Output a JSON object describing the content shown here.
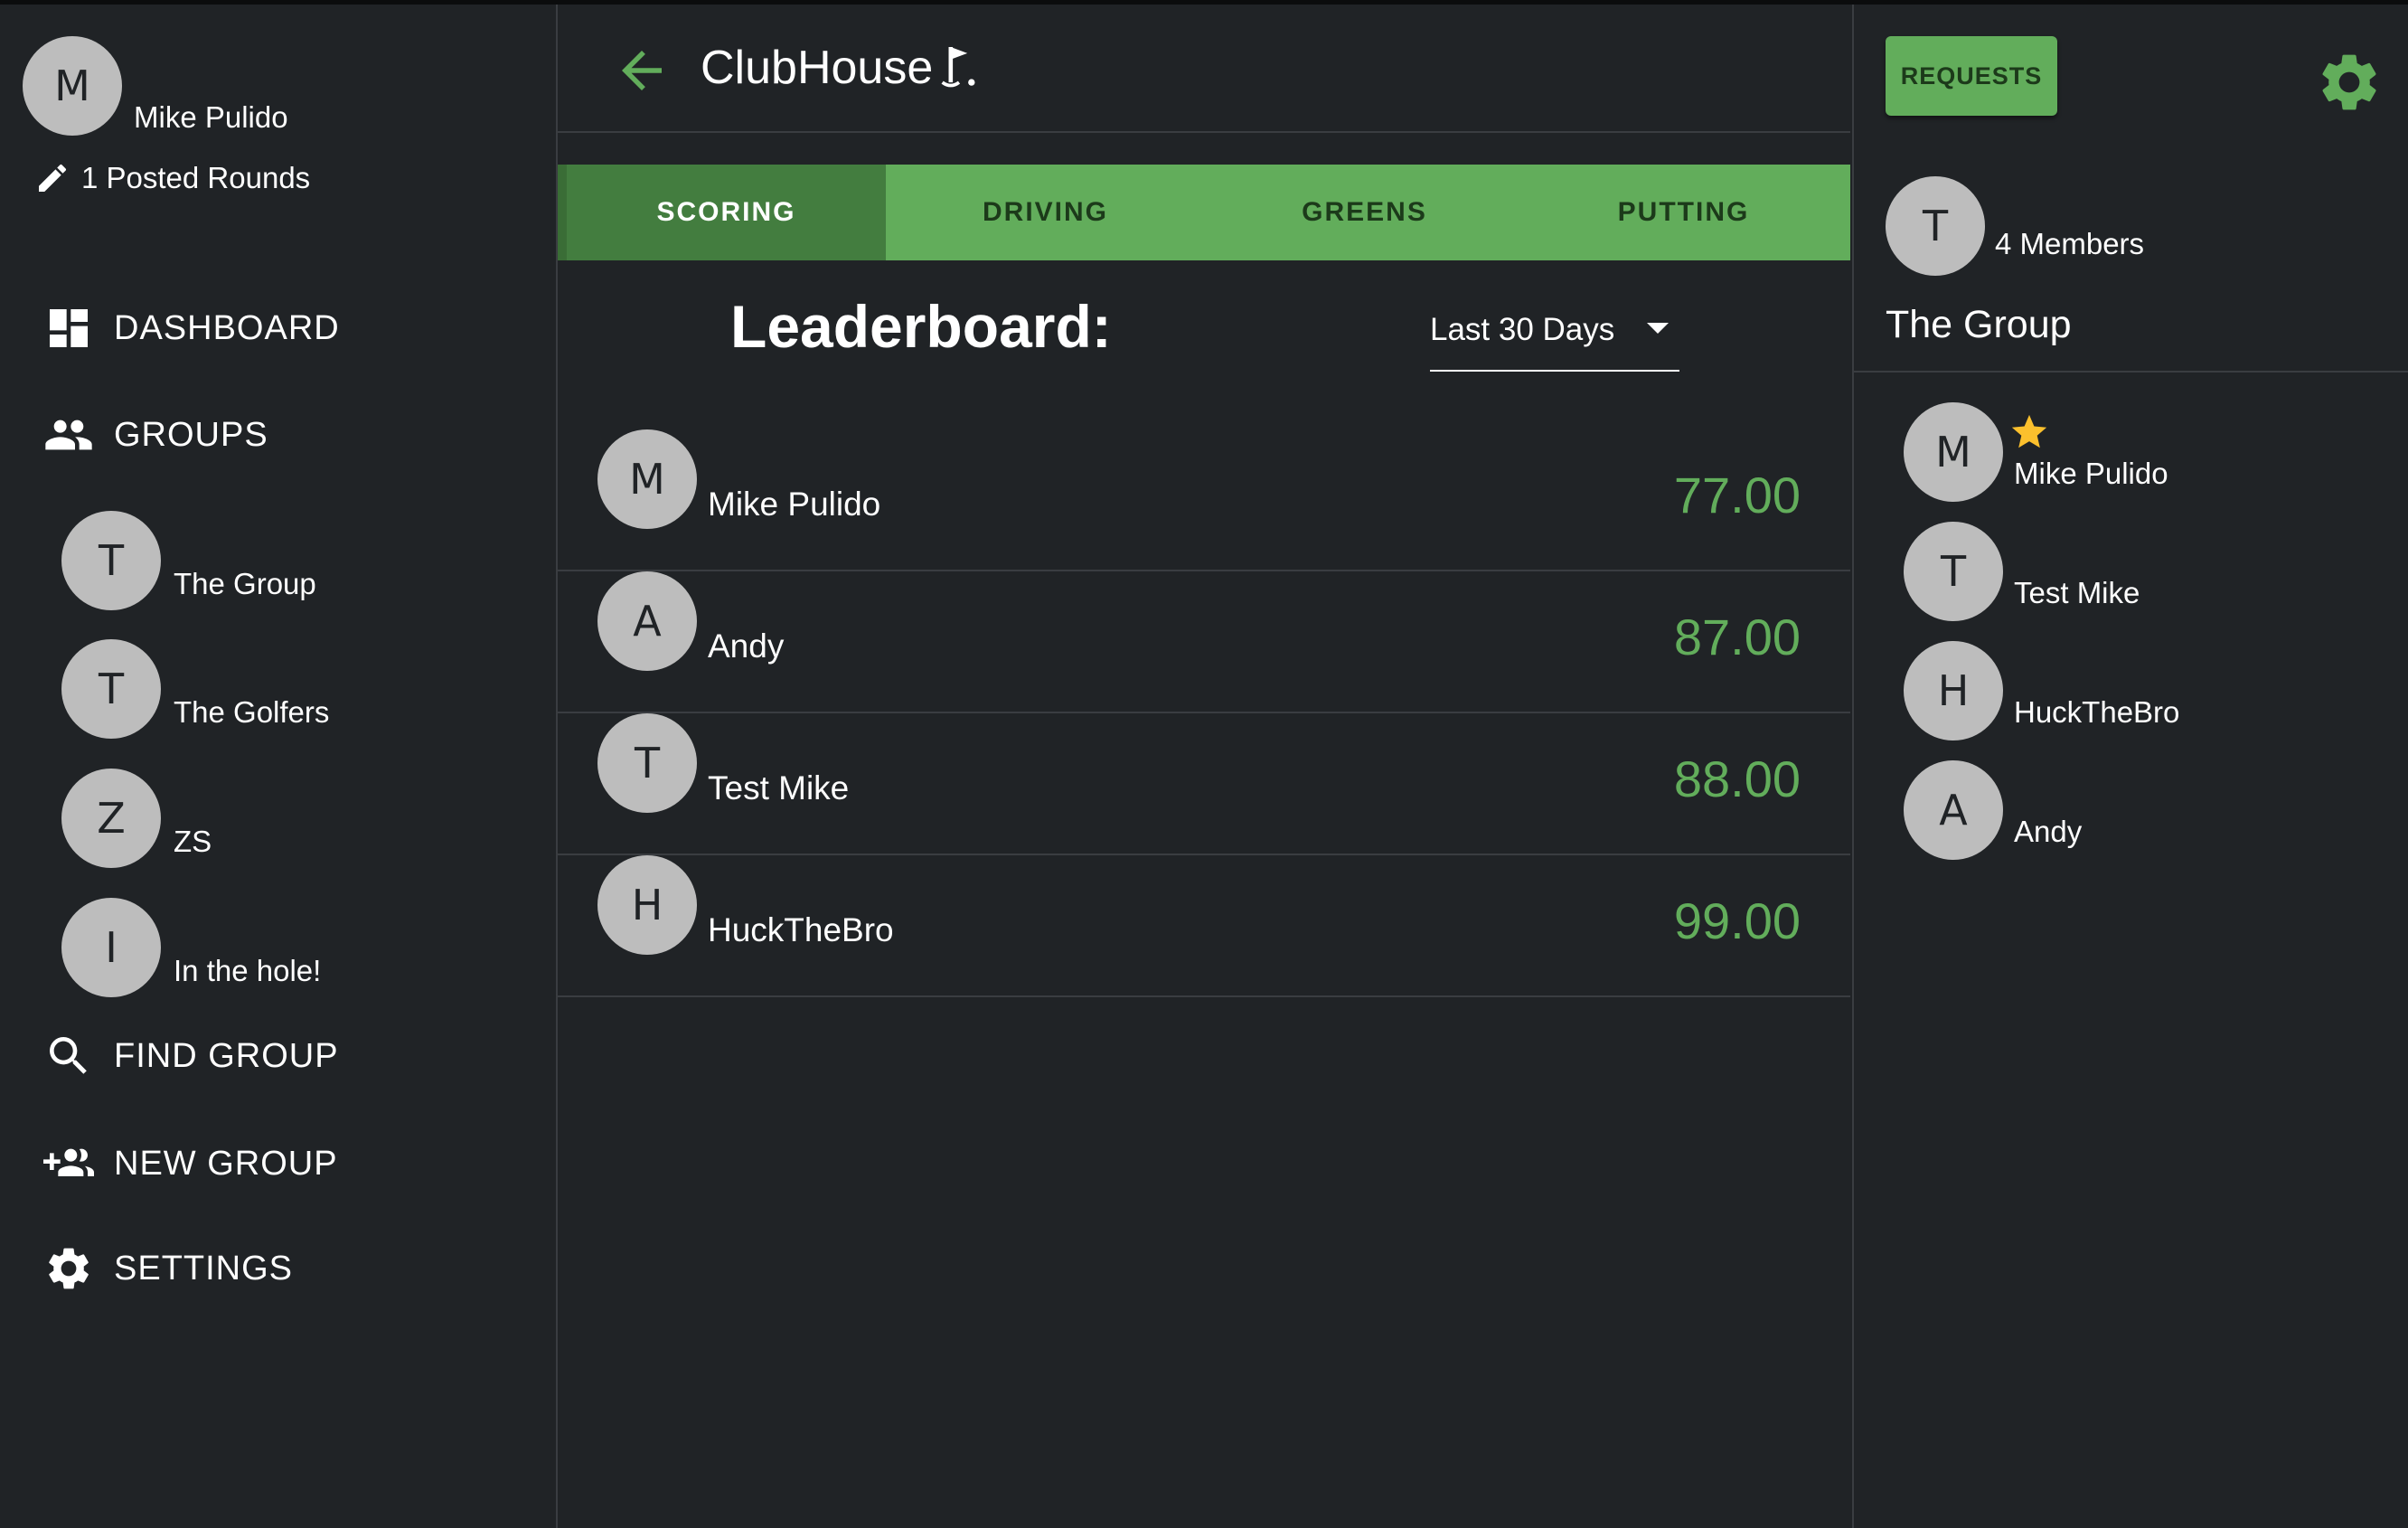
{
  "app": {
    "title": "ClubHouse"
  },
  "profile": {
    "initial": "M",
    "name": "Mike Pulido",
    "posted_rounds": "1 Posted Rounds"
  },
  "nav": {
    "dashboard": "DASHBOARD",
    "groups": "GROUPS",
    "find_group": "FIND GROUP",
    "new_group": "NEW GROUP",
    "settings": "SETTINGS"
  },
  "sidebar_groups": [
    {
      "initial": "T",
      "name": "The Group"
    },
    {
      "initial": "T",
      "name": "The Golfers"
    },
    {
      "initial": "Z",
      "name": "ZS"
    },
    {
      "initial": "I",
      "name": "In the hole!"
    }
  ],
  "tabs": [
    {
      "label": "SCORING",
      "active": true
    },
    {
      "label": "DRIVING",
      "active": false
    },
    {
      "label": "GREENS",
      "active": false
    },
    {
      "label": "PUTTING",
      "active": false
    }
  ],
  "leaderboard": {
    "title": "Leaderboard:",
    "period": "Last 30 Days",
    "rows": [
      {
        "initial": "M",
        "name": "Mike Pulido",
        "score": "77.00"
      },
      {
        "initial": "A",
        "name": "Andy",
        "score": "87.00"
      },
      {
        "initial": "T",
        "name": "Test Mike",
        "score": "88.00"
      },
      {
        "initial": "H",
        "name": "HuckTheBro",
        "score": "99.00"
      }
    ]
  },
  "group_panel": {
    "requests_label": "REQUESTS",
    "initial": "T",
    "members_count": "4 Members",
    "name": "The Group",
    "members": [
      {
        "initial": "M",
        "name": "Mike Pulido",
        "admin_star": true
      },
      {
        "initial": "T",
        "name": "Test Mike",
        "admin_star": false
      },
      {
        "initial": "H",
        "name": "HuckTheBro",
        "admin_star": false
      },
      {
        "initial": "A",
        "name": "Andy",
        "admin_star": false
      }
    ]
  },
  "colors": {
    "background": "#202326",
    "accent_green": "#62ad5b",
    "active_tab": "#437d3f",
    "avatar": "#bdbdbd",
    "star": "#fbc02d"
  }
}
